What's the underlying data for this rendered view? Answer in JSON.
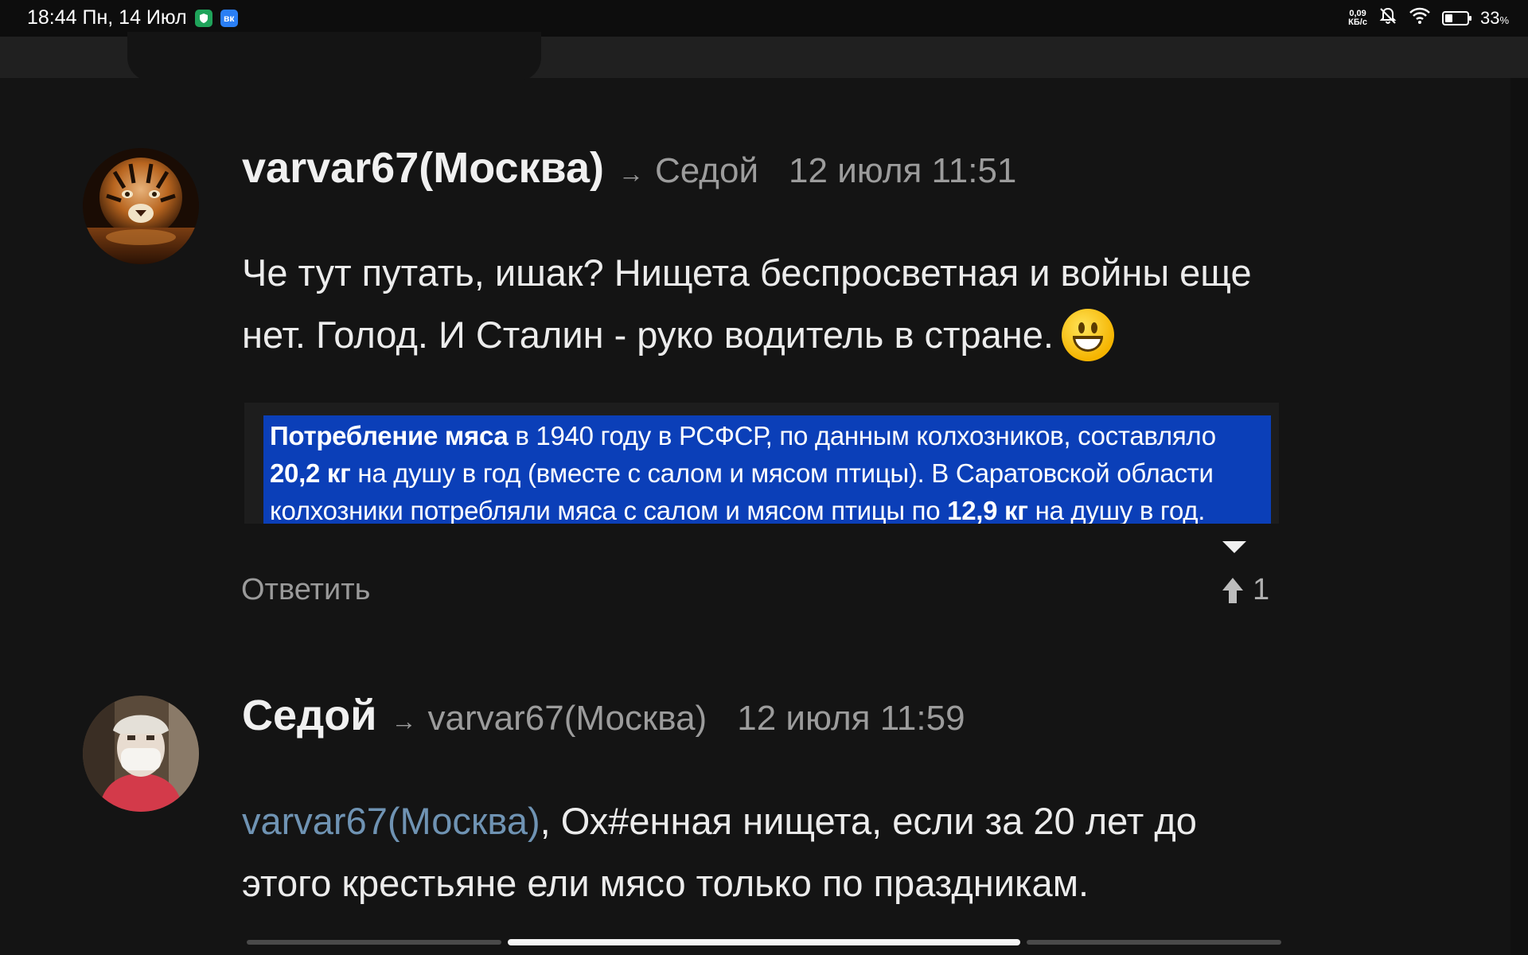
{
  "status_bar": {
    "time_date": "18:44 Пн, 14 Июл",
    "app_icon_2": "вк",
    "net_speed_value": "0,09",
    "net_speed_unit": "КБ/с",
    "battery_percent": "33",
    "battery_sign": "%",
    "battery_level": 0.33,
    "icons": [
      "shield-icon",
      "vk-icon",
      "bell-muted-icon",
      "wifi-icon",
      "battery-icon"
    ]
  },
  "comments": [
    {
      "author": "varvar67(Москва)",
      "arrow": "→",
      "reply_to": "Седой",
      "timestamp": "12 июля 11:51",
      "text": "Че тут путать, ишак? Нищета беспросветная и войны еще нет. Голод. И Сталин - руко водитель в стране.",
      "emoji": "grinning-face",
      "quote": {
        "b1": "Потребление мяса",
        "t1": " в 1940 году в РСФСР, по данным колхозников, составляло ",
        "b2": "20,2 кг",
        "t2": " на душу в год (вместе с салом и мясом птицы). В Саратовской области колхозники потребляли мяса с салом и мясом птицы по ",
        "b3": "12,9 кг",
        "t3": " на душу в год."
      },
      "reply_label": "Ответить",
      "vote_count": "1"
    },
    {
      "author": "Седой",
      "arrow": "→",
      "reply_to": "varvar67(Москва)",
      "timestamp": "12 июля 11:59",
      "mention": "varvar67(Москва)",
      "text": ", Ох#енная нищета, если за 20 лет до этого крестьяне ели мясо только по праздникам."
    }
  ]
}
